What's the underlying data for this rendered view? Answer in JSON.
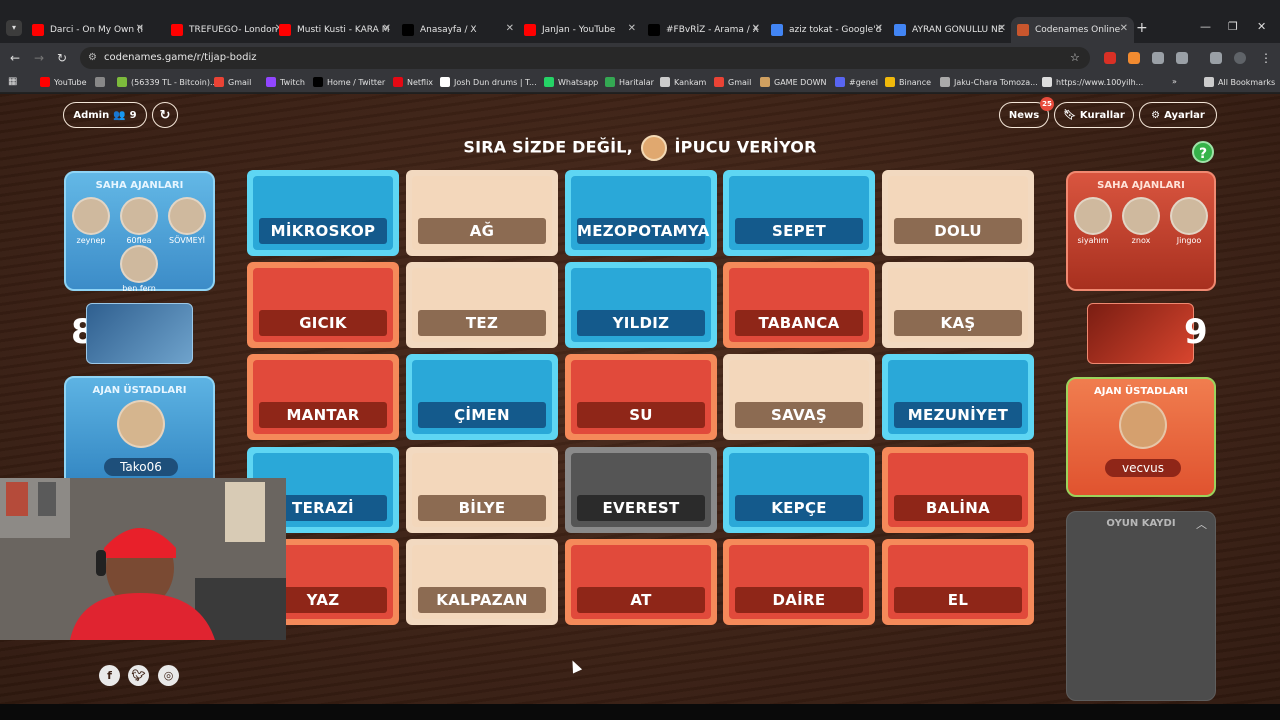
{
  "browser": {
    "tabs": [
      {
        "title": "Darci - On My Own (l",
        "icon": "youtube-icon",
        "color": "#ff0000"
      },
      {
        "title": "TREFUEGO- London",
        "icon": "youtube-icon",
        "color": "#ff0000"
      },
      {
        "title": "Musti Kusti - KARA M",
        "icon": "youtube-icon",
        "color": "#ff0000"
      },
      {
        "title": "Anasayfa / X",
        "icon": "x-icon",
        "color": "#000000"
      },
      {
        "title": "JanJan - YouTube",
        "icon": "youtube-icon",
        "color": "#ff0000"
      },
      {
        "title": "#FBvRİZ - Arama / X",
        "icon": "x-icon",
        "color": "#000000"
      },
      {
        "title": "aziz tokat - Google'd",
        "icon": "google-icon",
        "color": "#4285f4"
      },
      {
        "title": "AYRAN GONULLU NE",
        "icon": "google-icon",
        "color": "#4285f4"
      },
      {
        "title": "Codenames Online",
        "icon": "codenames-icon",
        "color": "#c8562d"
      }
    ],
    "url": "codenames.game/r/tijap-bodiz",
    "bookmarks": [
      {
        "label": "YouTube",
        "color": "#ff0000"
      },
      {
        "label": "",
        "color": "#888888"
      },
      {
        "label": "(56339 TL - Bitcoin)...",
        "color": "#7dbb3c"
      },
      {
        "label": "Gmail",
        "color": "#ea4335"
      },
      {
        "label": "Twitch",
        "color": "#9146ff"
      },
      {
        "label": "Home / Twitter",
        "color": "#000000"
      },
      {
        "label": "Netflix",
        "color": "#e50914"
      },
      {
        "label": "Josh Dun drums | T...",
        "color": "#ffffff"
      },
      {
        "label": "Whatsapp",
        "color": "#25d366"
      },
      {
        "label": "Haritalar",
        "color": "#34a853"
      },
      {
        "label": "Kankam",
        "color": "#cccccc"
      },
      {
        "label": "Gmail",
        "color": "#ea4335"
      },
      {
        "label": "GAME DOWN",
        "color": "#d0a060"
      },
      {
        "label": "#genel",
        "color": "#5865f2"
      },
      {
        "label": "Binance",
        "color": "#f0b90b"
      },
      {
        "label": "Jaku-Chara Tomoza...",
        "color": "#aaaaaa"
      },
      {
        "label": "https://www.100yilh...",
        "color": "#dddddd"
      }
    ],
    "all_bookmarks": "All Bookmarks"
  },
  "game": {
    "admin_label": "Admin",
    "player_count": "9",
    "news_label": "News",
    "news_badge": "25",
    "rules_label": "Kurallar",
    "settings_label": "Ayarlar",
    "turn_text_left": "SIRA SİZDE DEĞİL,",
    "turn_text_right": "İPUCU VERİYOR",
    "turn_avatar_name": "vecvus",
    "help": "?",
    "blue_team": {
      "field_agents_title": "SAHA AJANLARI",
      "agents": [
        "zeynep",
        "60flea",
        "SÖVMEYİ",
        "ben fern"
      ],
      "score": "8",
      "spymasters_title": "AJAN ÜSTADLARI",
      "spymaster": "Tako06"
    },
    "red_team": {
      "field_agents_title": "SAHA AJANLARI",
      "agents": [
        "siyahım",
        "znox",
        "Jingoo"
      ],
      "score": "9",
      "spymasters_title": "AJAN ÜSTADLARI",
      "spymaster": "vecvus"
    },
    "cards": [
      {
        "word": "MİKROSKOP",
        "team": "blue"
      },
      {
        "word": "AĞ",
        "team": "neutral"
      },
      {
        "word": "MEZOPOTAMYA",
        "team": "blue"
      },
      {
        "word": "SEPET",
        "team": "blue"
      },
      {
        "word": "DOLU",
        "team": "neutral"
      },
      {
        "word": "GICIK",
        "team": "red"
      },
      {
        "word": "TEZ",
        "team": "neutral"
      },
      {
        "word": "YILDIZ",
        "team": "blue"
      },
      {
        "word": "TABANCA",
        "team": "red"
      },
      {
        "word": "KAŞ",
        "team": "neutral"
      },
      {
        "word": "MANTAR",
        "team": "red"
      },
      {
        "word": "ÇİMEN",
        "team": "blue"
      },
      {
        "word": "SU",
        "team": "red"
      },
      {
        "word": "SAVAŞ",
        "team": "neutral"
      },
      {
        "word": "MEZUNİYET",
        "team": "blue"
      },
      {
        "word": "TERAZİ",
        "team": "blue"
      },
      {
        "word": "BİLYE",
        "team": "neutral"
      },
      {
        "word": "EVEREST",
        "team": "assassin"
      },
      {
        "word": "KEPÇE",
        "team": "blue"
      },
      {
        "word": "BALİNA",
        "team": "red"
      },
      {
        "word": "YAZ",
        "team": "red"
      },
      {
        "word": "KALPAZAN",
        "team": "neutral"
      },
      {
        "word": "AT",
        "team": "red"
      },
      {
        "word": "DAİRE",
        "team": "red"
      },
      {
        "word": "EL",
        "team": "red"
      }
    ],
    "game_log_title": "OYUN KAYDI",
    "social": [
      "facebook-icon",
      "twitter-icon",
      "instagram-icon"
    ]
  }
}
